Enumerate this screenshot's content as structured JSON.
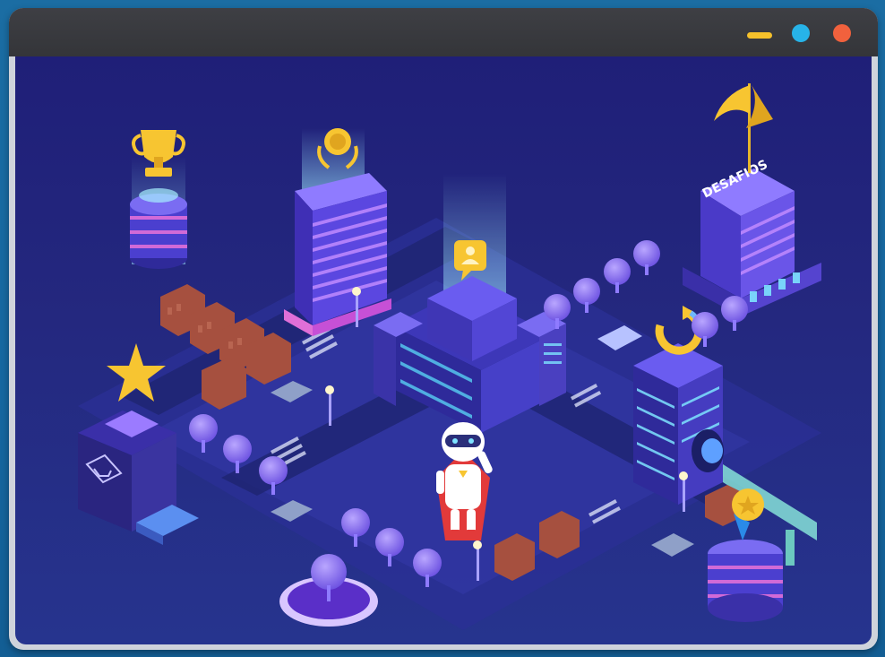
{
  "window": {
    "controls": [
      "minimize",
      "maximize",
      "close"
    ],
    "colors": {
      "minimize": "#f6c12b",
      "maximize": "#27b3e8",
      "close": "#f1613d",
      "titlebar": "#3a3b40"
    }
  },
  "scene": {
    "tower_sign": "DESAFIOS",
    "background": "#22267e",
    "accent_purple": "#7b5cf0",
    "accent_cyan": "#5ee6ff",
    "gold": "#f7c531",
    "icons": [
      "trophy-icon",
      "medal-icon",
      "flag-icon",
      "chat-user-icon",
      "star-icon",
      "shopping-cart-icon",
      "refresh-icon",
      "award-medal-icon",
      "robot-mascot"
    ]
  }
}
